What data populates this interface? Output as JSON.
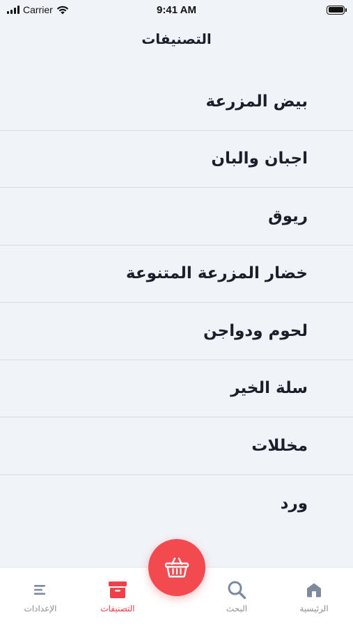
{
  "status_bar": {
    "carrier": "Carrier",
    "time": "9:41 AM"
  },
  "header": {
    "title": "التصنيفات"
  },
  "categories": [
    {
      "label": "بيض المزرعة"
    },
    {
      "label": "اجبان والبان"
    },
    {
      "label": "ريوق"
    },
    {
      "label": "خضار المزرعة المتنوعة"
    },
    {
      "label": "لحوم ودواجن"
    },
    {
      "label": "سلة الخير"
    },
    {
      "label": "مخللات"
    },
    {
      "label": "ورد"
    }
  ],
  "tab_bar": {
    "settings_label": "الإعدادات",
    "categories_label": "التصنيفات",
    "search_label": "البحث",
    "home_label": "الرئيسية",
    "active_tab": "categories"
  },
  "cart_button": {
    "icon": "basket-icon"
  },
  "colors": {
    "accent": "#f24a4f",
    "background": "#f0f3f8",
    "inactive": "#8a8f99"
  }
}
